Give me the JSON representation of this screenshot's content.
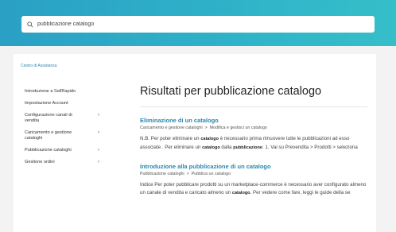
{
  "search": {
    "value": "pubblicazione catalogo"
  },
  "breadcrumb": "Centro di Assistenza",
  "sidebar": {
    "items": [
      {
        "label": "Introduzione a SellRapido",
        "chevron": ""
      },
      {
        "label": "Impostazione Account",
        "chevron": ""
      },
      {
        "label": "Configurazione canali di vendita",
        "chevron": "›"
      },
      {
        "label": "Caricamento e gestione cataloghi",
        "chevron": "›"
      },
      {
        "label": "Pubblicazione cataloghi",
        "chevron": "›"
      },
      {
        "label": "Gestione ordini",
        "chevron": "›"
      }
    ]
  },
  "main": {
    "heading": "Risultati per pubblicazione catalogo",
    "results": [
      {
        "title": "Eliminazione di un catalogo",
        "crumbs": [
          "Caricamento e gestione cataloghi",
          "Modifica e gestisci un catalogo"
        ],
        "sep": ">",
        "text_parts": [
          "N.B. Per poter eliminare un ",
          "catalogo",
          " è necessario prima rimuovere tutte le pubblicazioni ad esso associate . Per eliminare un ",
          "catalogo",
          " dalla ",
          "pubblicazione",
          ": 1. Vai su Prevendita > Prodotti > seleziona"
        ]
      },
      {
        "title": "Introduzione alla pubblicazione di un catalogo",
        "crumbs": [
          "Pubblicazione cataloghi",
          "Pubblica un catalogo"
        ],
        "sep": ">",
        "text_parts": [
          "Indice Per poter pubblicare prodotti su un marketplace-commerce è necessario aver configurato almeno un canale di vendita e caricato almeno un ",
          "catalogo",
          ". Per vedere come fare, leggi le guide della se"
        ]
      }
    ]
  },
  "colors": {
    "hero": "#2fb3c9",
    "link": "#2a86b0"
  },
  "icons": {
    "search": "search-icon",
    "chevron": "chevron-right-icon"
  }
}
